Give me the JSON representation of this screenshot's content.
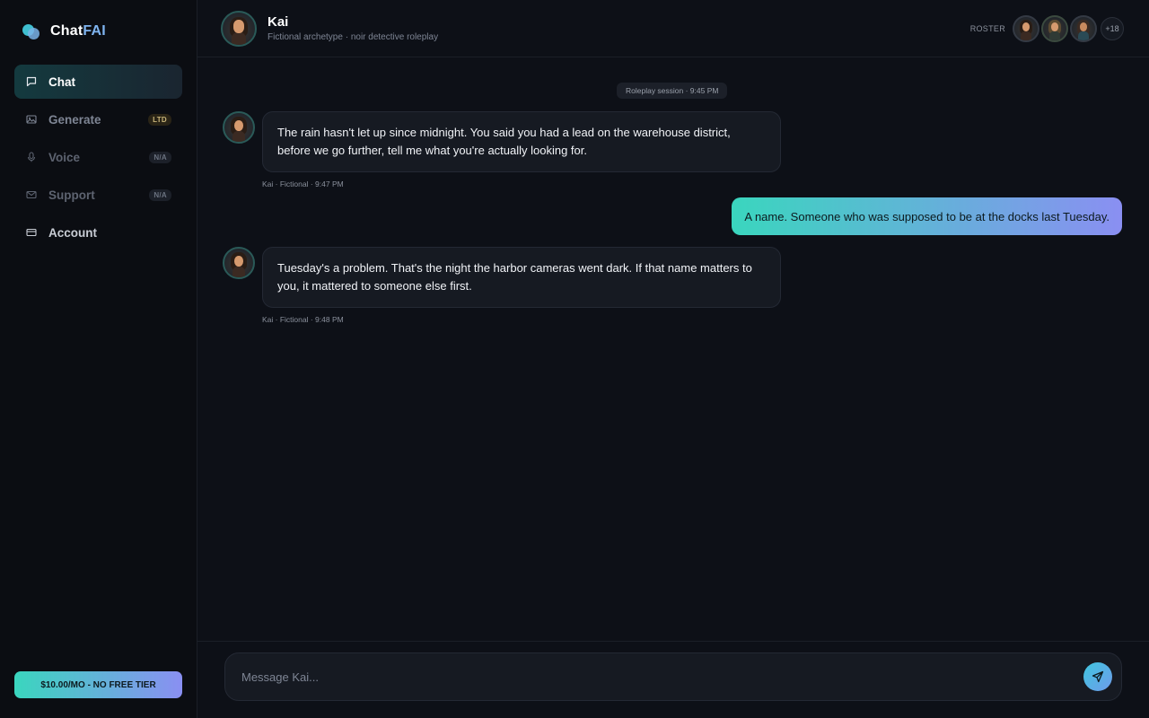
{
  "brand": {
    "name_main": "Chat",
    "name_accent": "FAI"
  },
  "sidebar": {
    "items": [
      {
        "label": "Chat",
        "icon": "chat-bubble-icon",
        "badge": ""
      },
      {
        "label": "Generate",
        "icon": "image-icon",
        "badge": "LTD"
      },
      {
        "label": "Voice",
        "icon": "microphone-icon",
        "badge": "N/A"
      },
      {
        "label": "Support",
        "icon": "mail-icon",
        "badge": "N/A"
      },
      {
        "label": "Account",
        "icon": "card-icon",
        "badge": ""
      }
    ],
    "plan_button": "$10.00/MO - NO FREE TIER"
  },
  "header": {
    "name": "Kai",
    "subtitle": "Fictional archetype · noir detective roleplay",
    "roster_label": "ROSTER",
    "roster_more": "+18"
  },
  "chat": {
    "session_label": "Roleplay session · 9:45 PM",
    "messages": [
      {
        "role": "bot",
        "text": "The rain hasn't let up since midnight. You said you had a lead on the warehouse district, before we go further, tell me what you're actually looking for.",
        "meta": "Kai · Fictional · 9:47 PM"
      },
      {
        "role": "user",
        "text": "A name. Someone who was supposed to be at the docks last Tuesday."
      },
      {
        "role": "bot",
        "text": "Tuesday's a problem. That's the night the harbor cameras went dark. If that name matters to you, it mattered to someone else first.",
        "meta": "Kai · Fictional · 9:48 PM"
      }
    ]
  },
  "composer": {
    "placeholder": "Message Kai..."
  },
  "colors": {
    "background": "#0d1017",
    "sidebar": "#0b0d12",
    "accent_start": "#3ad6be",
    "accent_end": "#8a8ff2"
  }
}
